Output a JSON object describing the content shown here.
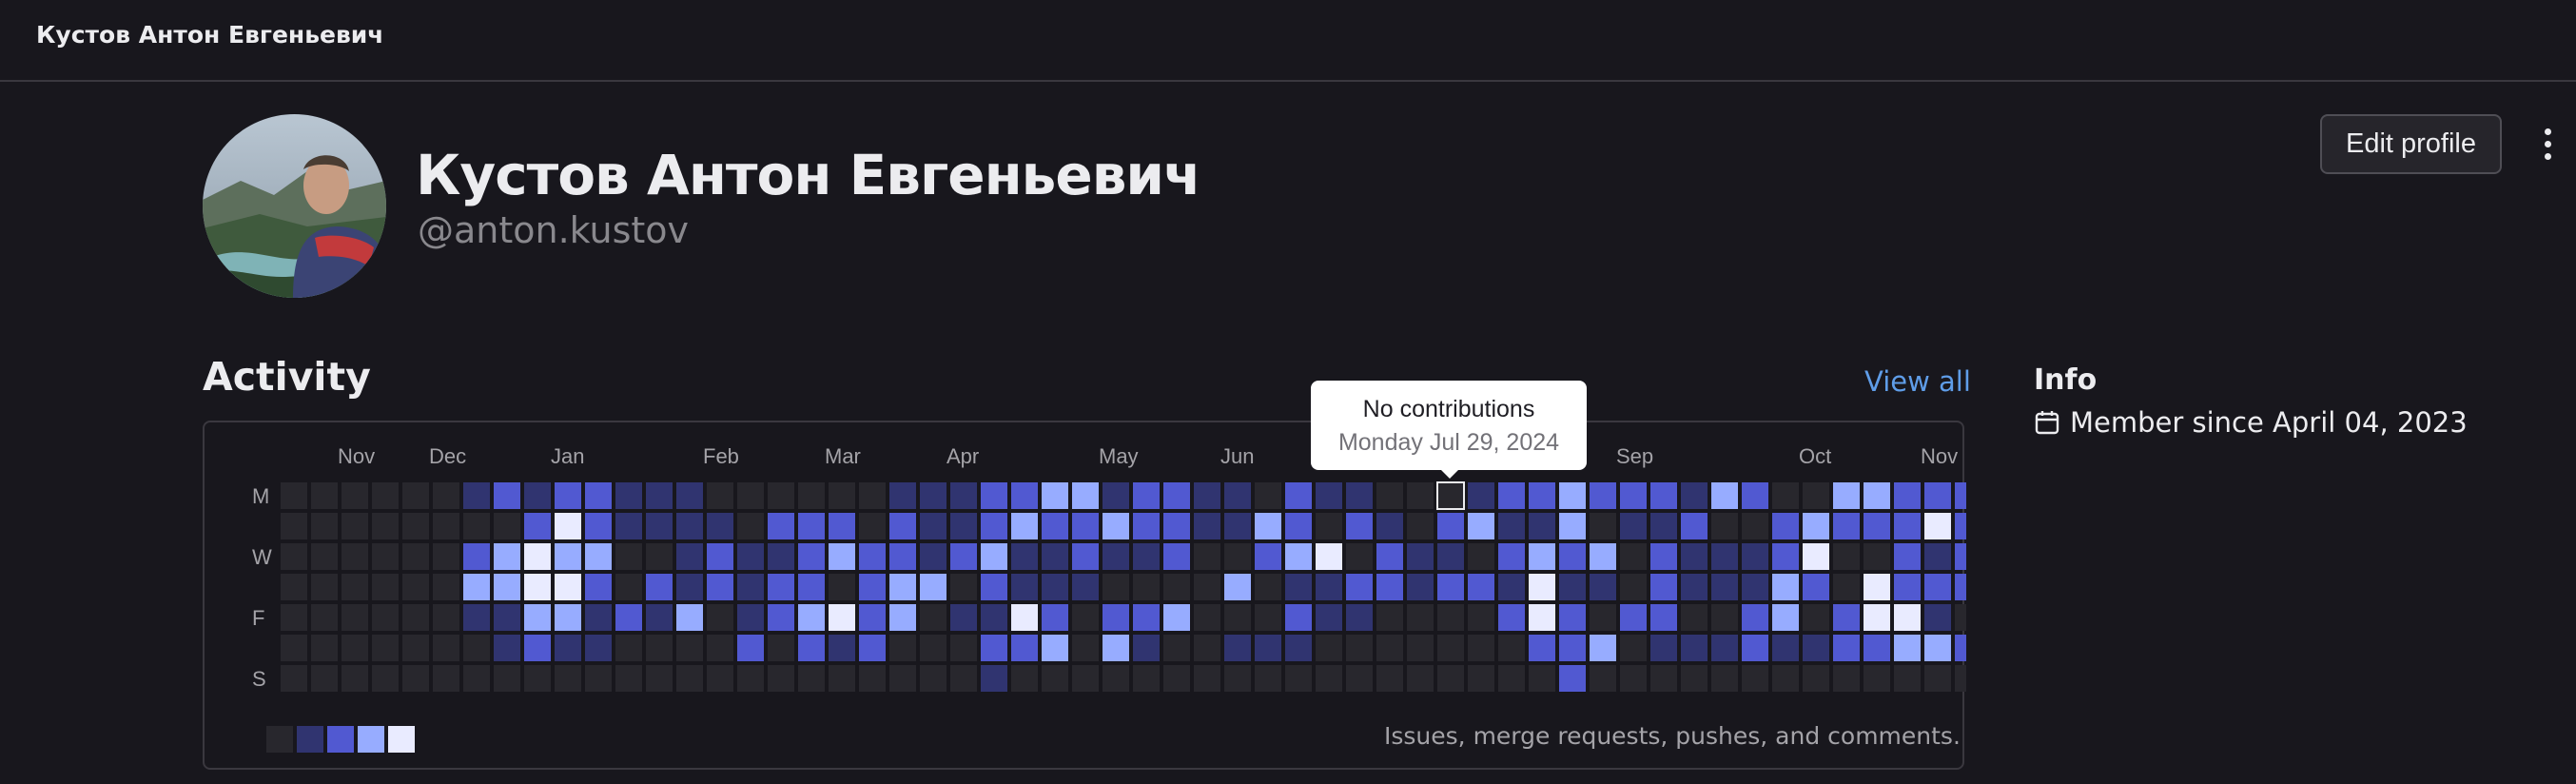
{
  "topbar": {
    "title": "Кустов Антон Евгеньевич"
  },
  "profile": {
    "name": "Кустов Антон Евгеньевич",
    "handle": "@anton.kustov",
    "edit_label": "Edit profile"
  },
  "activity": {
    "heading": "Activity",
    "view_all": "View all",
    "months": [
      "Nov",
      "Dec",
      "Jan",
      "Feb",
      "Mar",
      "Apr",
      "May",
      "Jun",
      "Sep",
      "Oct",
      "Nov"
    ],
    "day_labels": [
      "M",
      "W",
      "F",
      "S"
    ],
    "legend_caption": "Issues, merge requests, pushes, and comments.",
    "legend_levels": [
      0,
      1,
      2,
      3,
      4
    ],
    "level_colors": [
      "#28272d",
      "#303470",
      "#5159d1",
      "#97acff",
      "#e9ebff"
    ],
    "grid": [
      "0000001212211100000011122331221102110001223222132003322232122313121032231122110101",
      "0000000024211110222021123223221132021023113011200232224212020303221320324233321201",
      "0000002343300121123221231121120023402110232302111240021201113202232133242001231200",
      "0000003344202121220233021110000301122122141102111320422212311101133223323443002100",
      "0000001133121301234230114202230002110000242022002302441011004323233212213213342100",
      "0000000121100002021200022303100111000000022301112112233220000303312332232221112100",
      "0000000000000000000000010000000000000000002000000000000000000000000000000000000000"
    ],
    "highlight": {
      "week": 38,
      "day": 0
    },
    "tooltip": {
      "title": "No contributions",
      "date": "Monday Jul 29, 2024"
    }
  },
  "info": {
    "heading": "Info",
    "member_since": "Member since April 04, 2023",
    "icon": "calendar-icon"
  }
}
